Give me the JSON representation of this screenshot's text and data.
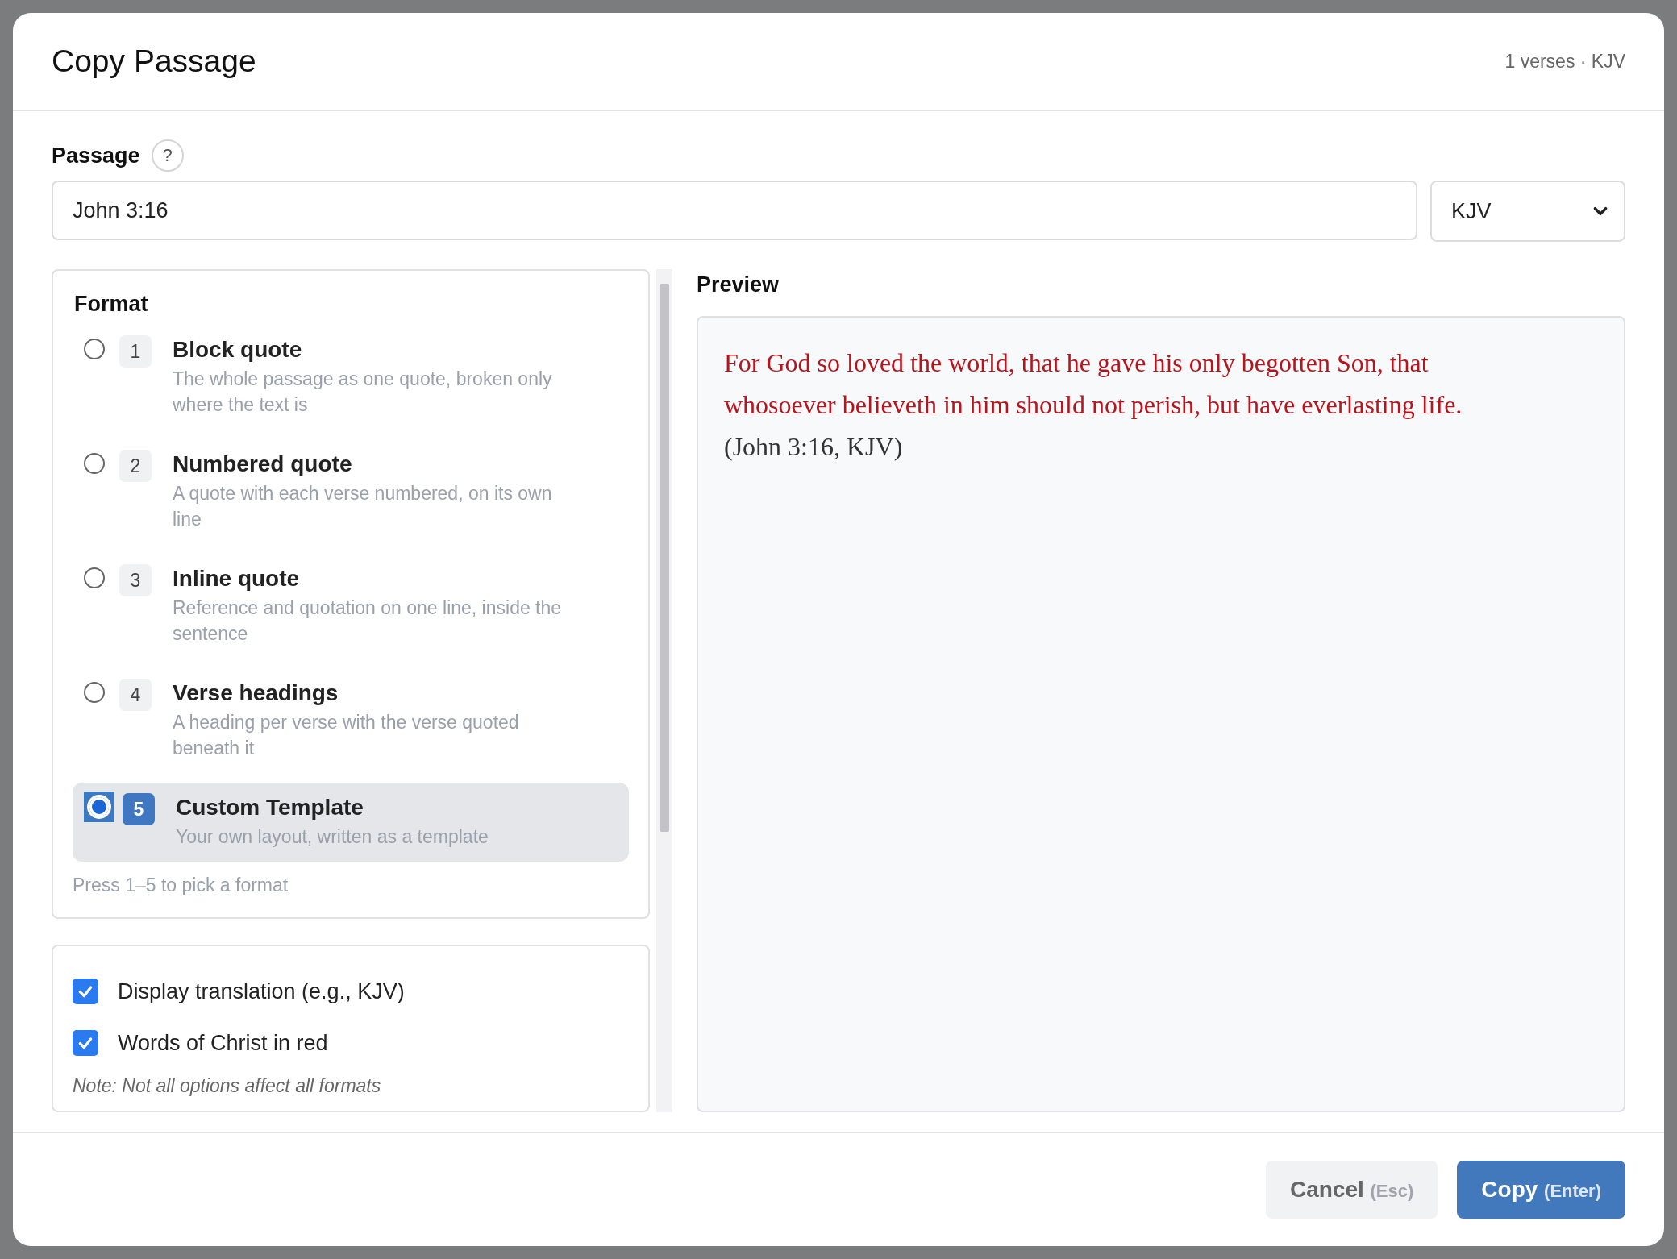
{
  "dialog": {
    "title": "Copy Passage",
    "summary": "1 verses · KJV"
  },
  "passage": {
    "label": "Passage",
    "help": "?",
    "value": "John 3:16",
    "translation": "KJV"
  },
  "format": {
    "title": "Format",
    "hint": "Press 1–5 to pick a format",
    "options": [
      {
        "number": "1",
        "title": "Block quote",
        "description": "The whole passage as one quote, broken only where the text is",
        "selected": false
      },
      {
        "number": "2",
        "title": "Numbered quote",
        "description": "A quote with each verse numbered, on its own line",
        "selected": false
      },
      {
        "number": "3",
        "title": "Inline quote",
        "description": "Reference and quotation on one line, inside the sentence",
        "selected": false
      },
      {
        "number": "4",
        "title": "Verse headings",
        "description": "A heading per verse with the verse quoted beneath it",
        "selected": false
      },
      {
        "number": "5",
        "title": "Custom Template",
        "description": "Your own layout, written as a template",
        "selected": true
      }
    ]
  },
  "settings": {
    "checkboxes": [
      {
        "label": "Display translation (e.g., KJV)",
        "checked": true
      },
      {
        "label": "Words of Christ in red",
        "checked": true
      }
    ],
    "note": "Note: Not all options affect all formats"
  },
  "preview": {
    "label": "Preview",
    "segments": [
      {
        "kind": "red",
        "text": "For God so loved the world, that he gave his only begotten Son, that whosoever believeth in him should not perish, but have everlasting life."
      },
      {
        "kind": "plain",
        "text": "(John 3:16, KJV)"
      }
    ]
  },
  "buttons": [
    {
      "kind": "secondary",
      "label": "Cancel",
      "shortcut": "(Esc)"
    },
    {
      "kind": "primary",
      "label": "Copy",
      "shortcut": "(Enter)"
    }
  ]
}
